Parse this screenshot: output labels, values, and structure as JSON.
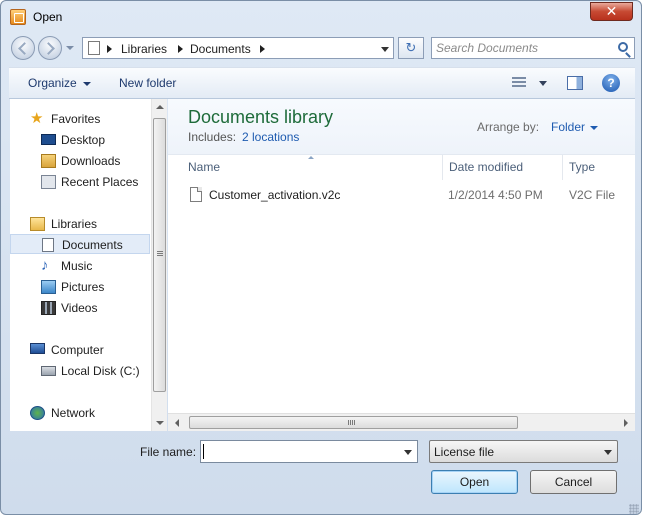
{
  "window": {
    "title": "Open",
    "close_glyph": "✕"
  },
  "navigation": {
    "breadcrumbs": [
      "Libraries",
      "Documents"
    ],
    "refresh_glyph": "↻",
    "search_placeholder": "Search Documents"
  },
  "toolbar": {
    "organize_label": "Organize",
    "new_folder_label": "New folder",
    "help_glyph": "?"
  },
  "sidebar": {
    "favorites": {
      "label": "Favorites",
      "items": [
        "Desktop",
        "Downloads",
        "Recent Places"
      ]
    },
    "libraries": {
      "label": "Libraries",
      "items": [
        "Documents",
        "Music",
        "Pictures",
        "Videos"
      ],
      "selected": "Documents"
    },
    "computer": {
      "label": "Computer",
      "items": [
        "Local Disk (C:)"
      ]
    },
    "network": {
      "label": "Network"
    }
  },
  "library": {
    "title": "Documents library",
    "includes_label": "Includes:",
    "locations_link": "2 locations",
    "arrange_by_label": "Arrange by:",
    "arrange_by_value": "Folder"
  },
  "file_list": {
    "columns": [
      "Name",
      "Date modified",
      "Type"
    ],
    "rows": [
      {
        "name": "Customer_activation.v2c",
        "date_modified": "1/2/2014 4:50 PM",
        "type": "V2C File"
      }
    ]
  },
  "footer": {
    "file_name_label": "File name:",
    "file_name_value": "",
    "file_type_value": "License file",
    "open_label": "Open",
    "cancel_label": "Cancel"
  },
  "scrollbars": {
    "h_grip_glyph": "III",
    "v_grip_glyph": "≡"
  },
  "colors": {
    "library_title": "#1e6b3a",
    "link": "#1e5bb0",
    "close_button": "#c74a33"
  }
}
